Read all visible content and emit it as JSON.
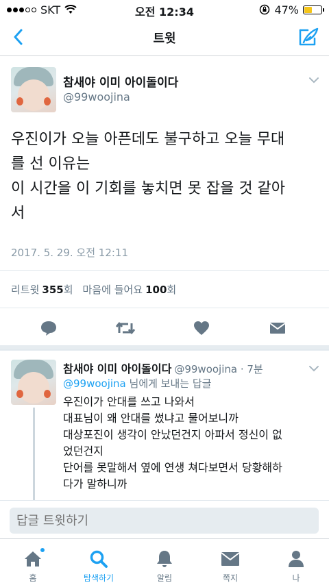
{
  "status_bar": {
    "carrier": "SKT",
    "time": "오전 12:34",
    "battery": "47%",
    "battery_level": 0.47,
    "signal_bars": 3,
    "signal_total": 5
  },
  "navbar": {
    "title": "트윗"
  },
  "tweet": {
    "author_name": "참새야 이미 아이돌이다",
    "author_handle": "@99woojina",
    "text_lines": [
      "우진이가 오늘 아픈데도 불구하고 오늘 무대",
      "를 선 이유는",
      "이 시간을 이 기회를 놓치면 못 잡을 것 같아",
      "서"
    ],
    "date": "2017. 5. 29. 오전 12:11",
    "retweets_label": "리트윗",
    "retweets_count": "355",
    "retweets_unit": "회",
    "likes_label": "마음에 들어요",
    "likes_count": "100",
    "likes_unit": "회"
  },
  "reply": {
    "author_name": "참새야 이미 아이돌이다",
    "meta": "@99woojina · 7분",
    "reply_to_mention": "@99woojina",
    "reply_to_suffix": " 님에게 보내는 답글",
    "text_lines": [
      "우진이가 안대를 쓰고 나와서",
      "대표님이 왜 안대를 썼냐고 물어보니까",
      "대상포진이 생각이 안났던건지 아파서 정신이 없",
      "었던건지",
      "단어를 못말해서 옆에 연생 쳐다보면서 당황해하",
      "다가 말하니까"
    ]
  },
  "reply_input": {
    "placeholder": "답글 트윗하기"
  },
  "tabs": [
    {
      "label": "홈",
      "icon": "home-icon"
    },
    {
      "label": "탐색하기",
      "icon": "search-icon"
    },
    {
      "label": "알림",
      "icon": "bell-icon"
    },
    {
      "label": "쪽지",
      "icon": "mail-icon"
    },
    {
      "label": "나",
      "icon": "person-icon"
    }
  ],
  "colors": {
    "accent": "#1da1f2",
    "icon_gray": "#657786",
    "battery": "#f5c518"
  }
}
